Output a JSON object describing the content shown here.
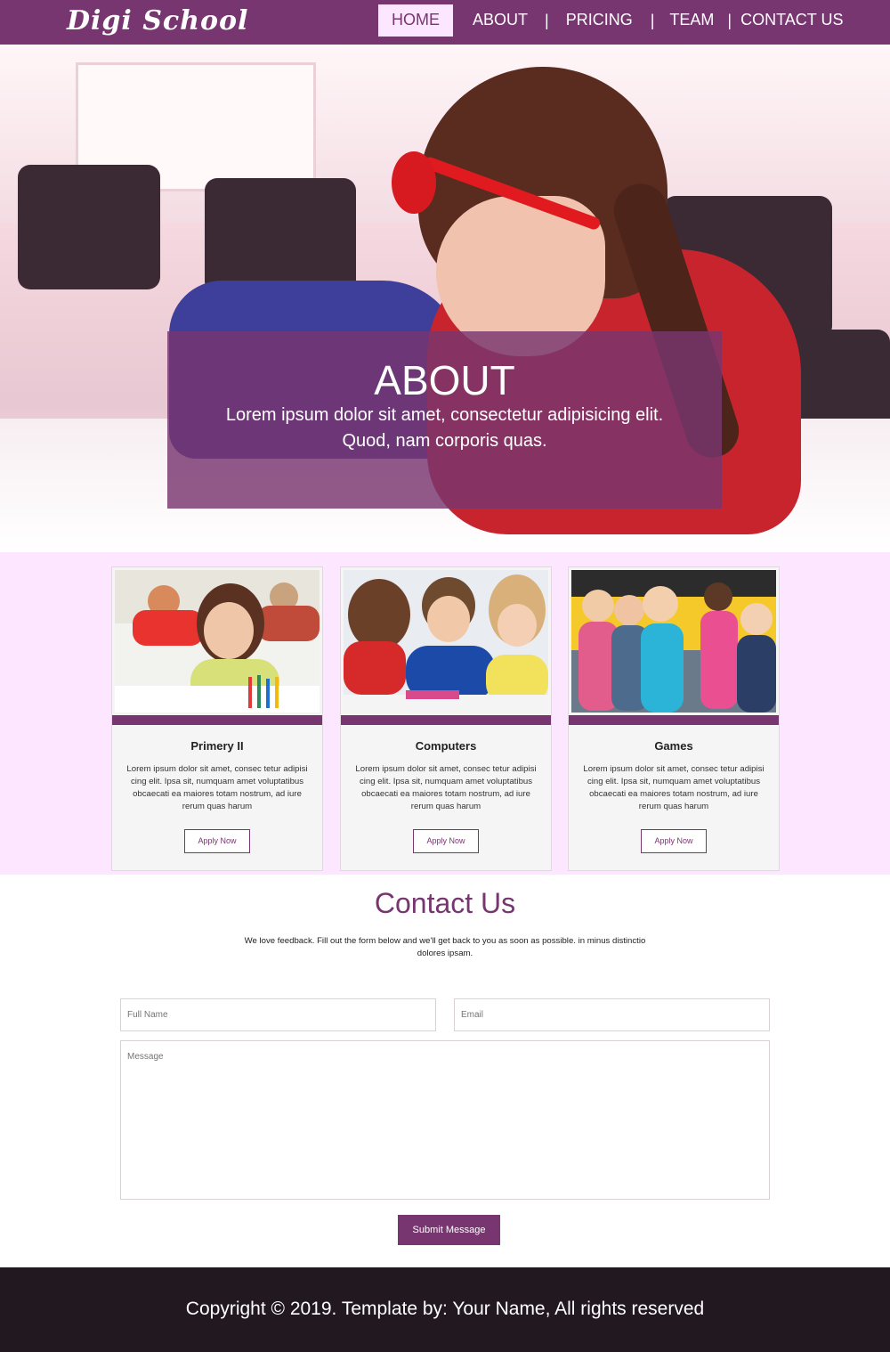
{
  "brand": {
    "logo_text": "Digi School"
  },
  "nav": {
    "items": [
      {
        "label": "HOME"
      },
      {
        "label": "ABOUT"
      },
      {
        "label": "PRICING"
      },
      {
        "label": "TEAM"
      },
      {
        "label": "CONTACT US"
      }
    ],
    "separator": "|",
    "active": "HOME"
  },
  "hero": {
    "title": "ABOUT",
    "text": "Lorem ipsum dolor sit amet, consectetur adipisicing elit. Quod, nam corporis quas."
  },
  "courses": [
    {
      "title": "Primery II",
      "description": "Lorem ipsum dolor sit amet, consec tetur adipisi cing elit. Ipsa sit, numquam amet voluptatibus obcaecati ea maiores totam nostrum, ad iure rerum quas harum",
      "button": "Apply Now"
    },
    {
      "title": "Computers",
      "description": "Lorem ipsum dolor sit amet, consec tetur adipisi cing elit. Ipsa sit, numquam amet voluptatibus obcaecati ea maiores totam nostrum, ad iure rerum quas harum",
      "button": "Apply Now"
    },
    {
      "title": "Games",
      "description": "Lorem ipsum dolor sit amet, consec tetur adipisi cing elit. Ipsa sit, numquam amet voluptatibus obcaecati ea maiores totam nostrum, ad iure rerum quas harum",
      "button": "Apply Now"
    }
  ],
  "contact": {
    "title": "Contact Us",
    "subtitle": "We love feedback. Fill out the form below and we'll get back to you as soon as possible. in minus distinctio dolores ipsam.",
    "full_name_placeholder": "Full Name",
    "email_placeholder": "Email",
    "message_placeholder": "Message",
    "submit_label": "Submit Message"
  },
  "footer": {
    "text": "Copyright © 2019. Template by: Your Name, All rights reserved"
  },
  "colors": {
    "primary": "#77366f",
    "light_pink": "#fde6ff",
    "footer_bg": "#221820"
  }
}
